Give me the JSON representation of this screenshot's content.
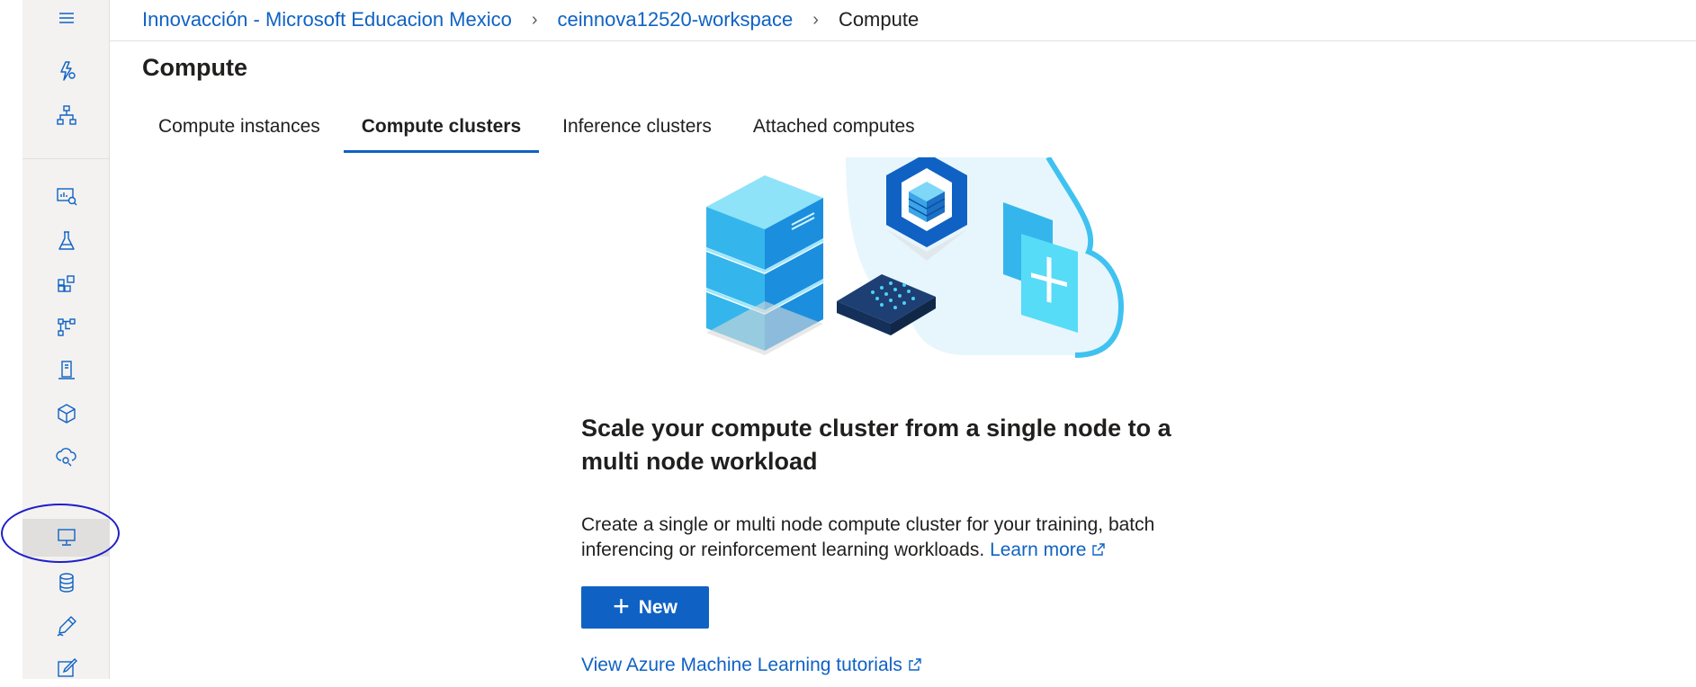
{
  "breadcrumb": {
    "items": [
      "Innovacción - Microsoft Educacion Mexico",
      "ceinnova12520-workspace"
    ],
    "current": "Compute"
  },
  "page": {
    "title": "Compute"
  },
  "tabs": [
    {
      "label": "Compute instances",
      "active": false
    },
    {
      "label": "Compute clusters",
      "active": true
    },
    {
      "label": "Inference clusters",
      "active": false
    },
    {
      "label": "Attached computes",
      "active": false
    }
  ],
  "sidebar": {
    "icons": [
      "hamburger-menu-icon",
      "automl-lightning-icon",
      "designer-hierarchy-icon",
      "notebooks-icon",
      "experiments-flask-icon",
      "models-blocks-icon",
      "pipelines-icon",
      "endpoints-icon",
      "models-cube-icon",
      "cloud-deploy-icon",
      "compute-monitor-icon",
      "datastores-icon",
      "data-labeling-pen-icon",
      "edit-icon"
    ],
    "active": "compute-monitor-icon"
  },
  "empty_state": {
    "title": "Scale your compute cluster from a single node to a multi node workload",
    "description": "Create a single or multi node compute cluster for your training, batch inferencing or reinforcement learning workloads.",
    "learn_more": "Learn more",
    "new_button": "New",
    "tutorials_link": "View Azure Machine Learning tutorials"
  },
  "colors": {
    "accent": "#0f62c4",
    "annotation": "#1f1fc8",
    "sidebar_bg": "#f3f2f1"
  }
}
